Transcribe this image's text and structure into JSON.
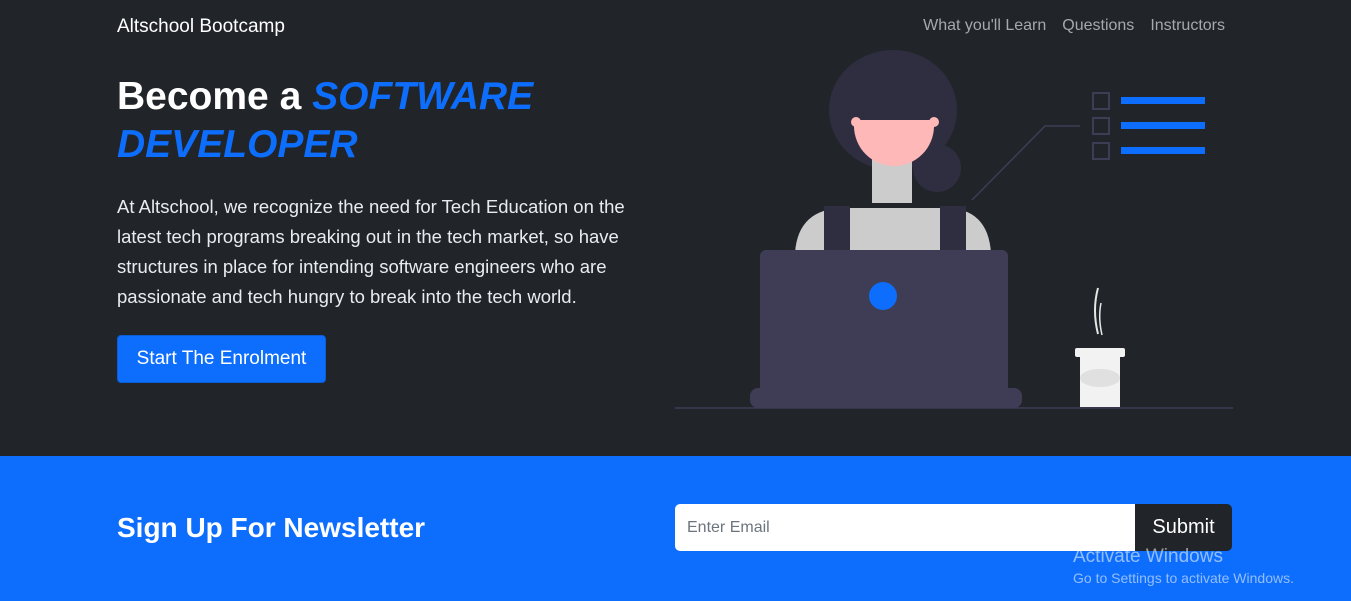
{
  "header": {
    "brand": "Altschool Bootcamp",
    "nav": [
      "What you'll Learn",
      "Questions",
      "Instructors"
    ]
  },
  "hero": {
    "headline_plain": "Become a ",
    "headline_accent_1": "SOFTWARE",
    "headline_accent_2": "DEVELOPER",
    "description": "At Altschool, we recognize the need for Tech Education on the latest tech programs breaking out in the tech market, so have structures in place for intending software engineers who are passionate and tech hungry to break into the tech world.",
    "cta_label": "Start The Enrolment",
    "illustration_icon": "woman-at-laptop-illustration"
  },
  "newsletter": {
    "title": "Sign Up For Newsletter",
    "email_placeholder": "Enter Email",
    "email_value": "",
    "submit_label": "Submit"
  },
  "watermark": {
    "title": "Activate Windows",
    "subtitle": "Go to Settings to activate Windows."
  },
  "colors": {
    "dark_bg": "#212529",
    "accent": "#0d6efd",
    "illustration_dark": "#3f3d56",
    "skin": "#ffb8b8",
    "shirt": "#cccccc"
  }
}
